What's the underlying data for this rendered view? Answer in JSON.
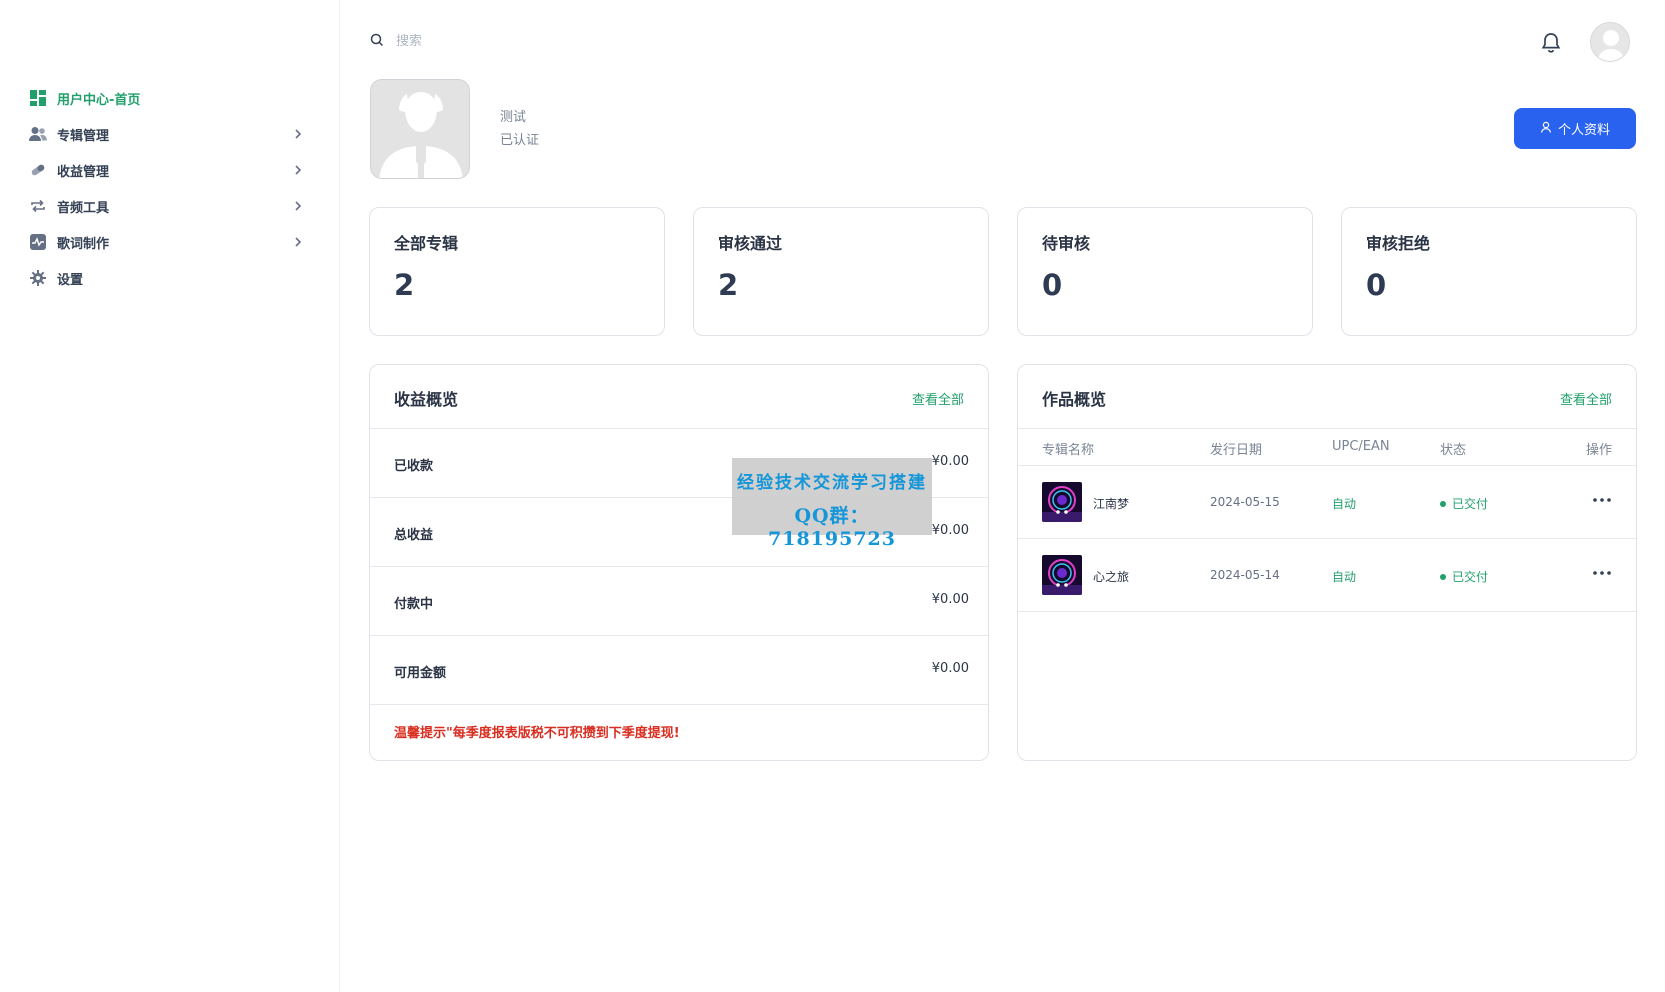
{
  "sidebar": {
    "items": [
      {
        "label": "用户中心-首页",
        "icon": "dashboard-icon",
        "active": true,
        "has_children": false
      },
      {
        "label": "专辑管理",
        "icon": "users-icon",
        "active": false,
        "has_children": true
      },
      {
        "label": "收益管理",
        "icon": "pill-icon",
        "active": false,
        "has_children": true
      },
      {
        "label": "音频工具",
        "icon": "repeat-icon",
        "active": false,
        "has_children": true
      },
      {
        "label": "歌词制作",
        "icon": "pulse-icon",
        "active": false,
        "has_children": true
      },
      {
        "label": "设置",
        "icon": "gear-icon",
        "active": false,
        "has_children": false
      }
    ]
  },
  "header": {
    "search_placeholder": "搜索"
  },
  "profile": {
    "name": "测试",
    "status": "已认证",
    "button_label": "个人资料"
  },
  "stats": [
    {
      "label": "全部专辑",
      "value": "2"
    },
    {
      "label": "审核通过",
      "value": "2"
    },
    {
      "label": "待审核",
      "value": "0"
    },
    {
      "label": "审核拒绝",
      "value": "0"
    }
  ],
  "income": {
    "title": "收益概览",
    "view_all": "查看全部",
    "rows": [
      {
        "label": "已收款",
        "value": "¥0.00"
      },
      {
        "label": "总收益",
        "value": "¥0.00"
      },
      {
        "label": "付款中",
        "value": "¥0.00"
      },
      {
        "label": "可用金额",
        "value": "¥0.00"
      }
    ],
    "notice": "温馨提示\"每季度报表版税不可积攒到下季度提现!"
  },
  "watermark": {
    "line1": "经验技术交流学习搭建",
    "line2": "QQ群：718195723"
  },
  "works": {
    "title": "作品概览",
    "view_all": "查看全部",
    "columns": [
      "专辑名称",
      "发行日期",
      "UPC/EAN",
      "状态",
      "操作"
    ],
    "rows": [
      {
        "name": "江南梦",
        "date": "2024-05-15",
        "upc": "自动",
        "status": "已交付"
      },
      {
        "name": "心之旅",
        "date": "2024-05-14",
        "upc": "自动",
        "status": "已交付"
      }
    ]
  },
  "colors": {
    "accent_green": "#22a06b",
    "primary_blue": "#2a62f0",
    "notice_red": "#d92d20"
  }
}
